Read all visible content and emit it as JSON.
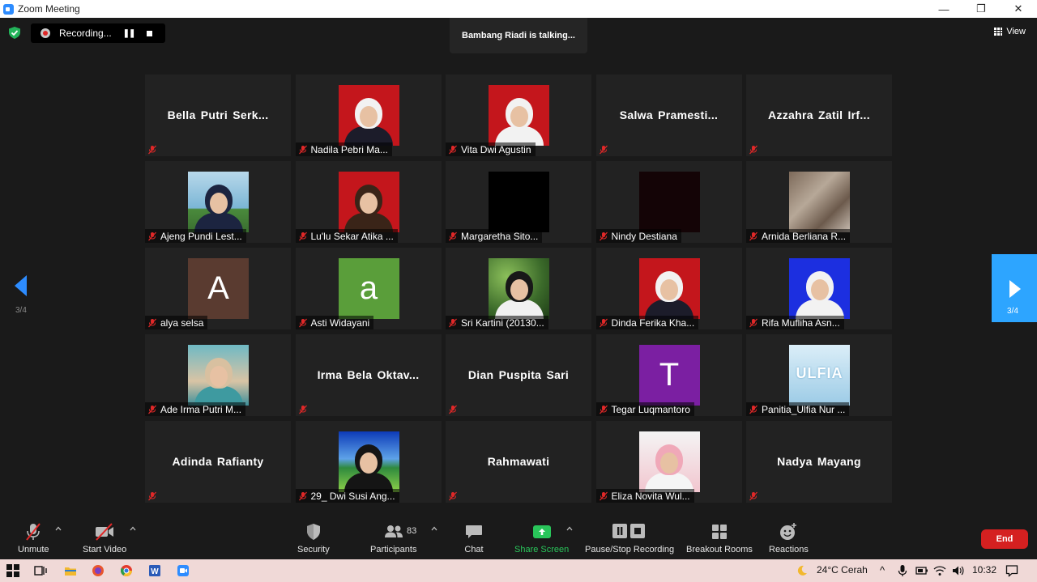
{
  "window": {
    "title": "Zoom Meeting",
    "minimize": "—",
    "restore": "❐",
    "close": "✕"
  },
  "recording": {
    "label": "Recording...",
    "pause": "❚❚"
  },
  "talking": "Bambang Riadi is talking...",
  "view": {
    "label": "View"
  },
  "pager": {
    "prev_label": "3/4",
    "next_label": "3/4"
  },
  "colors": {
    "accent": "#2d8cff",
    "end": "#d52020",
    "share": "#29c55a",
    "mic_off": "#e02828"
  },
  "participants": [
    {
      "name": "Bella  Putri  Serk...",
      "type": "name"
    },
    {
      "name": "Nadila Pebri Ma...",
      "type": "photo",
      "photo": "bg-red",
      "hijab": "#f2f2f2",
      "body": "#1c1c2a"
    },
    {
      "name": "Vita Dwi Agustin",
      "type": "photo",
      "photo": "bg-red",
      "hijab": "#f2f2f2",
      "body": "#f2f2f2"
    },
    {
      "name": "Salwa  Pramesti...",
      "type": "name"
    },
    {
      "name": "Azzahra  Zatil  Irf...",
      "type": "name"
    },
    {
      "name": "Ajeng Pundi Lest...",
      "type": "photo",
      "photo": "bg-sky",
      "hijab": "#1c2440",
      "body": "#1c2440"
    },
    {
      "name": "Lu'lu Sekar Atika ...",
      "type": "photo",
      "photo": "bg-red",
      "hijab": "#3a2418",
      "body": "#3a2418"
    },
    {
      "name": "Margaretha Sito...",
      "type": "photo",
      "photo": "bg-black"
    },
    {
      "name": "Nindy Destiana",
      "type": "photo",
      "photo": "bg-darkred"
    },
    {
      "name": "Arnida Berliana R...",
      "type": "photo",
      "photo": "bg-forest"
    },
    {
      "name": "alya selsa",
      "type": "letter",
      "letter": "A",
      "photo": "bg-brown"
    },
    {
      "name": "Asti Widayani",
      "type": "letter",
      "letter": "a",
      "photo": "bg-green"
    },
    {
      "name": "Sri Kartini (20130...",
      "type": "photo",
      "photo": "bg-leaves",
      "hijab": "#181818",
      "body": "#f0f0f0"
    },
    {
      "name": "Dinda Ferika Kha...",
      "type": "photo",
      "photo": "bg-red",
      "hijab": "#f2f2f2",
      "body": "#1c1c2a"
    },
    {
      "name": "Rifa Mufliha Asn...",
      "type": "photo",
      "photo": "bg-blue",
      "hijab": "#f2f2f2",
      "body": "#f2f2f2"
    },
    {
      "name": "Ade Irma Putri M...",
      "type": "photo",
      "photo": "bg-teal",
      "hijab": "#d8c0a0",
      "body": "#3e9aa0"
    },
    {
      "name": "Irma  Bela  Oktav...",
      "type": "name"
    },
    {
      "name": "Dian Puspita Sari",
      "type": "name"
    },
    {
      "name": "Tegar Luqmantoro",
      "type": "letter",
      "letter": "T",
      "photo": "bg-purple"
    },
    {
      "name": "Panitia_Ulfia Nur ...",
      "type": "logo",
      "photo": "bg-logo",
      "logo": "ULFIA"
    },
    {
      "name": "Adinda Rafianty",
      "type": "name"
    },
    {
      "name": "29_ Dwi Susi Ang...",
      "type": "photo",
      "photo": "bg-scene",
      "hijab": "#151515",
      "body": "#151515"
    },
    {
      "name": "Rahmawati",
      "type": "name"
    },
    {
      "name": "Eliza Novita Wul...",
      "type": "photo",
      "photo": "bg-pink",
      "hijab": "#f0a8b8",
      "body": "#f5f5f5"
    },
    {
      "name": "Nadya Mayang",
      "type": "name"
    }
  ],
  "toolbar": {
    "unmute": "Unmute",
    "start_video": "Start Video",
    "security": "Security",
    "participants": "Participants",
    "participants_count": "83",
    "chat": "Chat",
    "share_screen": "Share Screen",
    "pause_stop_recording": "Pause/Stop Recording",
    "breakout_rooms": "Breakout Rooms",
    "reactions": "Reactions",
    "end": "End"
  },
  "taskbar": {
    "weather": "24°C  Cerah",
    "time": "10:32"
  }
}
